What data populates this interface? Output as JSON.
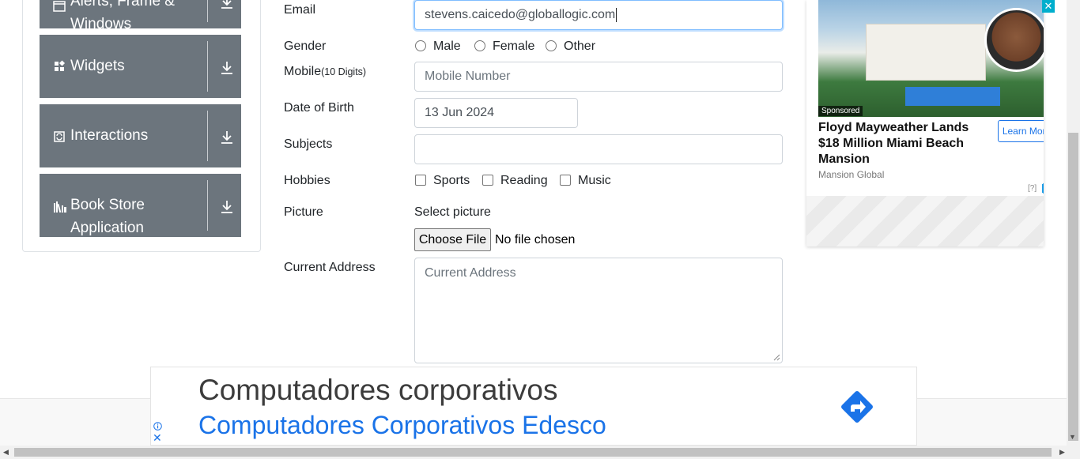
{
  "sidebar": {
    "groups": [
      {
        "label_line1": "Alerts, Frame &",
        "label_line2": "Windows",
        "icon": "window-icon"
      },
      {
        "label": "Widgets",
        "icon": "widgets-icon"
      },
      {
        "label": "Interactions",
        "icon": "interactions-icon"
      },
      {
        "label_line1": "Book Store",
        "label_line2": "Application",
        "icon": "bookstore-icon"
      }
    ]
  },
  "form": {
    "email": {
      "label": "Email",
      "value": "stevens.caicedo@globallogic.com"
    },
    "gender": {
      "label": "Gender",
      "options": [
        "Male",
        "Female",
        "Other"
      ]
    },
    "mobile": {
      "label": "Mobile",
      "label_note": "(10 Digits)",
      "placeholder": "Mobile Number"
    },
    "dob": {
      "label": "Date of Birth",
      "value": "13 Jun 2024"
    },
    "subjects": {
      "label": "Subjects",
      "value": ""
    },
    "hobbies": {
      "label": "Hobbies",
      "options": [
        "Sports",
        "Reading",
        "Music"
      ]
    },
    "picture": {
      "label": "Picture",
      "select_text": "Select picture",
      "button": "Choose File",
      "status": "No file chosen"
    },
    "address": {
      "label": "Current Address",
      "placeholder": "Current Address"
    }
  },
  "ad_right": {
    "sponsored": "Sponsored",
    "headline": "Floyd Mayweather Lands $18 Million Miami Beach Mansion",
    "source": "Mansion Global",
    "cta": "Learn More",
    "help": "[?]",
    "close": "✕"
  },
  "ad_bottom": {
    "title": "Computadores corporativos",
    "subtitle": "Computadores Corporativos Edesco",
    "close": "✕"
  },
  "colors": {
    "sidebar_group": "#6c757d",
    "focus_border": "#80bdff",
    "ad_blue": "#1a73e8",
    "ad_close": "#00aecd"
  }
}
